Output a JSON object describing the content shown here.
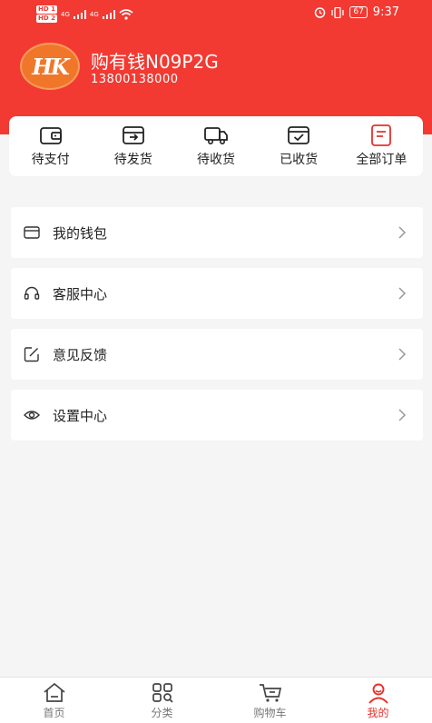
{
  "status_bar": {
    "sim1": "HD 1",
    "sim2": "HD 2",
    "network": "4G",
    "battery": "67",
    "time": "9:37"
  },
  "profile": {
    "avatar_text": "HK",
    "name": "购有钱N09P2G",
    "phone": "13800138000"
  },
  "orders": [
    {
      "label": "待支付",
      "icon": "wallet-icon"
    },
    {
      "label": "待发货",
      "icon": "box-arrow-icon"
    },
    {
      "label": "待收货",
      "icon": "truck-icon"
    },
    {
      "label": "已收货",
      "icon": "received-check-icon"
    },
    {
      "label": "全部订单",
      "icon": "order-list-icon"
    }
  ],
  "menu": [
    {
      "label": "我的钱包",
      "icon": "card-icon"
    },
    {
      "label": "客服中心",
      "icon": "headset-icon"
    },
    {
      "label": "意见反馈",
      "icon": "edit-icon"
    },
    {
      "label": "设置中心",
      "icon": "eye-icon"
    }
  ],
  "tabbar": [
    {
      "label": "首页",
      "icon": "home-icon"
    },
    {
      "label": "分类",
      "icon": "grid-icon"
    },
    {
      "label": "购物车",
      "icon": "cart-icon"
    },
    {
      "label": "我的",
      "icon": "user-icon",
      "active": true
    }
  ],
  "colors": {
    "brand": "#f23a32",
    "active_tab": "#e8302b",
    "background": "#f5f5f5"
  }
}
